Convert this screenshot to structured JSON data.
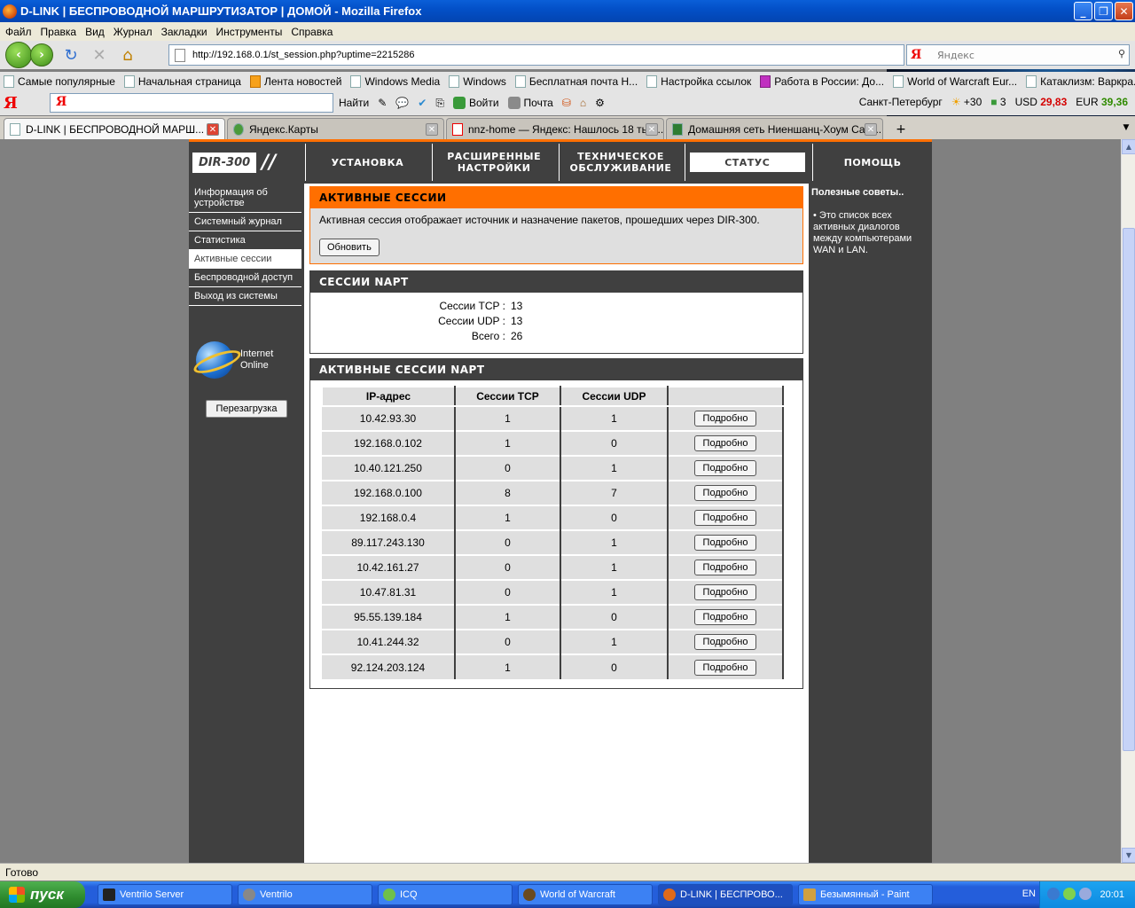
{
  "window": {
    "title": "D-LINK | БЕСПРОВОДНОЙ МАРШРУТИЗАТОР | ДОМОЙ - Mozilla Firefox"
  },
  "menu": [
    "Файл",
    "Правка",
    "Вид",
    "Журнал",
    "Закладки",
    "Инструменты",
    "Справка"
  ],
  "nav": {
    "url": "http://192.168.0.1/st_session.php?uptime=2215286",
    "search_placeholder": "Яндекс"
  },
  "bookmarks": [
    "Самые популярные",
    "Начальная страница",
    "Лента новостей",
    "Windows Media",
    "Windows",
    "Бесплатная почта Н...",
    "Настройка ссылок",
    "Работа в России: До...",
    "World of Warcraft Eur...",
    "Катаклизм: Варкра..."
  ],
  "yandex_bar": {
    "find": "Найти",
    "login": "Войти",
    "mail": "Почта",
    "city": "Санкт-Петербург",
    "temp": "+30",
    "count": "3",
    "usd_label": "USD",
    "usd": "29,83",
    "eur_label": "EUR",
    "eur": "39,36"
  },
  "tabs": [
    {
      "label": "D-LINK | БЕСПРОВОДНОЙ МАРШ...",
      "active": true
    },
    {
      "label": "Яндекс.Карты",
      "active": false
    },
    {
      "label": "nnz-home — Яндекс: Нашлось 18 тыс...",
      "active": false
    },
    {
      "label": "Домашняя сеть Ниеншанц-Хоум Санк...",
      "active": false
    }
  ],
  "router": {
    "logo": "DIR-300",
    "top_tabs": [
      "УСТАНОВКА",
      "РАСШИРЕННЫЕ НАСТРОЙКИ",
      "ТЕХНИЧЕСКОЕ ОБСЛУЖИВАНИЕ",
      "СТАТУС",
      "ПОМОЩЬ"
    ],
    "side_menu": [
      "Информация об устройстве",
      "Системный журнал",
      "Статистика",
      "Активные сессии",
      "Беспроводной доступ",
      "Выход из системы"
    ],
    "side_active": 3,
    "ie": {
      "line1": "Internet",
      "line2": "Online"
    },
    "reboot": "Перезагрузка",
    "active_sessions": {
      "title": "АКТИВНЫЕ СЕССИИ",
      "description": "Активная сессия отображает источник и назначение пакетов, прошедших через DIR-300.",
      "refresh": "Обновить"
    },
    "napt": {
      "title": "СЕССИИ NAPT",
      "tcp_label": "Сессии TCP :",
      "tcp": "13",
      "udp_label": "Сессии UDP :",
      "udp": "13",
      "total_label": "Всего :",
      "total": "26"
    },
    "active_napt": {
      "title": "АКТИВНЫЕ СЕССИИ NAPT",
      "columns": [
        "IP-адрес",
        "Сессии TCP",
        "Сессии UDP",
        ""
      ],
      "detail_label": "Подробно",
      "rows": [
        [
          "10.42.93.30",
          "1",
          "1"
        ],
        [
          "192.168.0.102",
          "1",
          "0"
        ],
        [
          "10.40.121.250",
          "0",
          "1"
        ],
        [
          "192.168.0.100",
          "8",
          "7"
        ],
        [
          "192.168.0.4",
          "1",
          "0"
        ],
        [
          "89.117.243.130",
          "0",
          "1"
        ],
        [
          "10.42.161.27",
          "0",
          "1"
        ],
        [
          "10.47.81.31",
          "0",
          "1"
        ],
        [
          "95.55.139.184",
          "1",
          "0"
        ],
        [
          "10.41.244.32",
          "0",
          "1"
        ],
        [
          "92.124.203.124",
          "1",
          "0"
        ]
      ]
    },
    "help": {
      "title": "Полезные советы..",
      "text": "Это список всех активных диалогов между компьютерами WAN и LAN."
    }
  },
  "status": "Готово",
  "taskbar": {
    "start": "пуск",
    "tasks": [
      {
        "label": "Ventrilo Server",
        "active": false
      },
      {
        "label": "Ventrilo",
        "active": false
      },
      {
        "label": "ICQ",
        "active": false
      },
      {
        "label": "World of Warcraft",
        "active": false
      },
      {
        "label": "D-LINK | БЕСПРОВО...",
        "active": true
      },
      {
        "label": "Безымянный - Paint",
        "active": false
      }
    ],
    "lang": "EN",
    "clock": "20:01"
  }
}
